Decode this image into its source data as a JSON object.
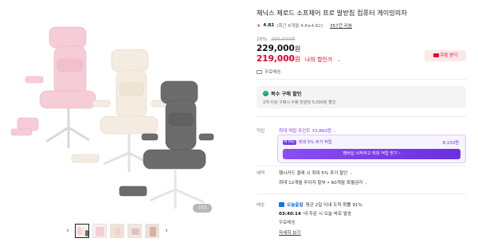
{
  "product": {
    "title": "제닉스 제로드 소프체어 프로 발받침 컴퓨터 게이밍의자",
    "rating": {
      "star_icon": "star-icon",
      "score": "4.82",
      "detail": "(최근 6개월 4.8",
      "detail_end": ")",
      "reviews": "357건 리뷰"
    },
    "discount_rate": "26%",
    "original_price": "299,000원",
    "price": "229,000",
    "price_unit": "원",
    "my_price": "219,000",
    "my_price_unit": "원",
    "my_price_label": "나의 할인가",
    "coupon_button": "쿠폰 받기",
    "free_shipping": "무료배송"
  },
  "gallery": {
    "counter": "1/11",
    "prev_icon": "chevron-left-icon",
    "next_icon": "chevron-right-icon",
    "thumbnail_count": 5,
    "active_index": 0
  },
  "multi_purchase": {
    "title": "복수 구매 할인",
    "subtitle": "2개 이상 구매시 수량 만원당 5,000원 할인"
  },
  "points": {
    "label": "적립",
    "max_points": "최대 적립 포인트 33,860원",
    "extra_badge": "N Pay",
    "extra_text": "최대 5% 추가 적립",
    "extra_amount": "8,150원",
    "cta": "멤버십 시작하고 최대 적립 받기"
  },
  "benefits": {
    "label": "혜택",
    "card": "햄시카드 결제 시 최대 5% 추가 할인",
    "installment": "최대 12개월 무이자 할부 • 60개월 특별금리"
  },
  "delivery": {
    "label": "배송",
    "today_badge": "오늘출발",
    "rate": "평균 2일 이내 도착 확률 91%",
    "timer": "03:40:14",
    "timer_text": "내 주문 시 오늘 바로 발송",
    "fee": "무료배송",
    "more": "자세히 보기"
  },
  "colors": {
    "accent_red": "#e4002b",
    "accent_purple": "#7b3fe4",
    "accent_blue": "#1a6fe0",
    "success_green": "#17a85c"
  }
}
